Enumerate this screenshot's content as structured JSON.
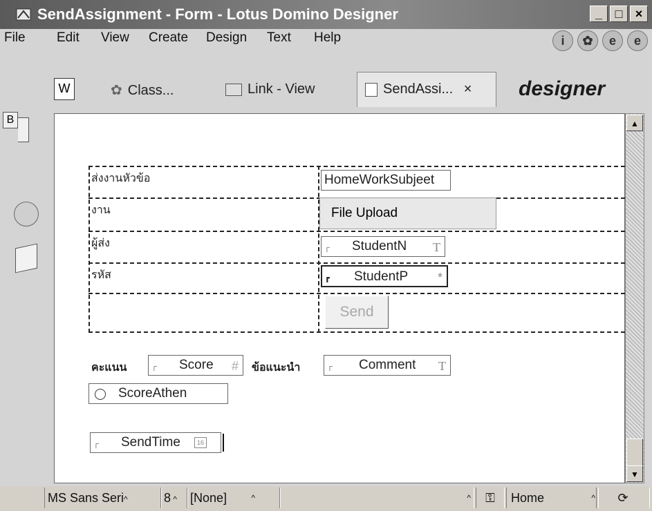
{
  "window": {
    "title": "SendAssignment - Form - Lotus Domino Designer",
    "controls": {
      "minimize": "_",
      "maximize": "□",
      "close": "×"
    }
  },
  "menu": {
    "file": "File",
    "edit": "Edit",
    "view": "View",
    "create": "Create",
    "design": "Design",
    "text": "Text",
    "help": "Help"
  },
  "toolbar_icons": [
    "info-icon",
    "web-icon",
    "browser-icon",
    "internet-explorer-icon"
  ],
  "tabs": [
    {
      "label": "Class...",
      "icon": "class-icon"
    },
    {
      "label": "Link - View",
      "icon": "view-icon"
    },
    {
      "label": "SendAssi...",
      "icon": "form-icon",
      "close": "×",
      "active": true
    }
  ],
  "w_tab": "W",
  "brand": "designer",
  "left_buttons": {
    "b": "B"
  },
  "form": {
    "rows": [
      {
        "label": "ส่งงานหัวข้อ",
        "field": "HomeWorkSubjeet"
      },
      {
        "label": "งาน",
        "field": "File Upload"
      },
      {
        "label": "ผู้ส่ง",
        "field": "StudentN",
        "type": "T"
      },
      {
        "label": "รหัส",
        "field": "StudentP",
        "type": "*"
      }
    ],
    "send_button": "Send",
    "score_label": "คะแนน",
    "score_field": "Score",
    "score_type": "#",
    "comment_label": "ข้อแนะนำ",
    "comment_field": "Comment",
    "comment_type": "T",
    "radio_field": "ScoreAthen",
    "sendtime_field": "SendTime",
    "sendtime_type": "16"
  },
  "statusbar": {
    "font": "MS Sans Seri",
    "size": "8",
    "style": "[None]",
    "location": "Home"
  }
}
